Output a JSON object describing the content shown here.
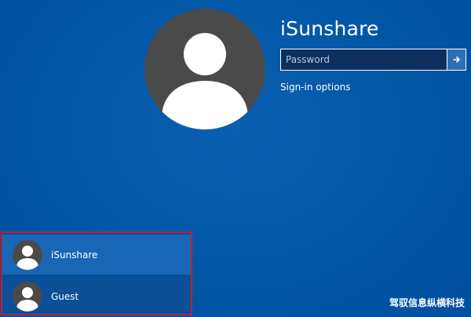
{
  "account": {
    "username": "iSunshare",
    "avatar_icon": "user-silhouette-icon"
  },
  "password": {
    "placeholder": "Password",
    "value": "",
    "submit_icon": "arrow-right-icon"
  },
  "signin_options_label": "Sign-in options",
  "user_list": [
    {
      "label": "iSunshare",
      "icon": "user-silhouette-icon",
      "selected": true
    },
    {
      "label": "Guest",
      "icon": "user-silhouette-icon",
      "selected": false
    }
  ],
  "watermark": "驾驭信息纵横科技",
  "colors": {
    "background": "#0057a8",
    "avatar_bg": "#4a4a4a",
    "password_box_bg": "#0d2f5e",
    "submit_button_bg": "#2e6fb3",
    "selected_item_bg": "#1866b6",
    "highlight_border": "#c0202a"
  }
}
